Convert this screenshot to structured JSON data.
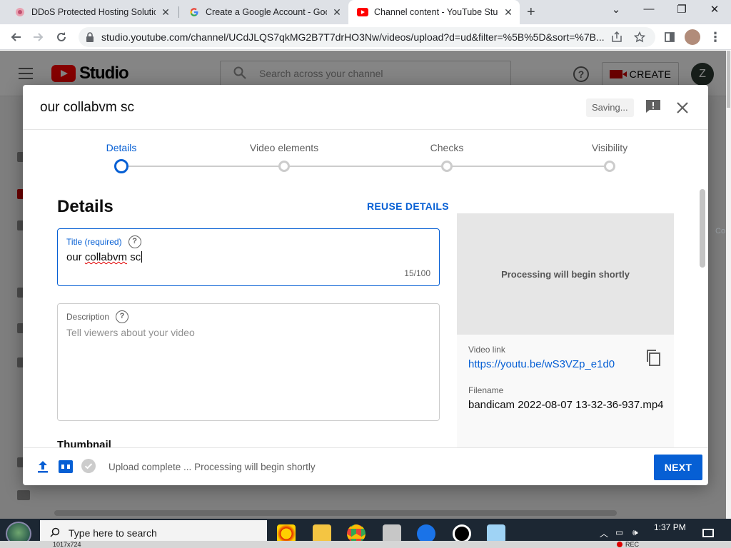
{
  "browser": {
    "tabs": [
      {
        "title": "DDoS Protected Hosting Solution",
        "icon": "ddos-favicon"
      },
      {
        "title": "Create a Google Account - Goog",
        "icon": "google-favicon"
      },
      {
        "title": "Channel content - YouTube Studi",
        "icon": "youtube-favicon",
        "active": true
      }
    ],
    "address": "studio.youtube.com/channel/UCdJLQS7qkMG2B7T7drHO3Nw/videos/upload?d=ud&filter=%5B%5D&sort=%7B...",
    "window_controls": {
      "minimize": "—",
      "restore": "❐",
      "close": "✕",
      "menu": "⌄"
    }
  },
  "studio": {
    "logo_text": "Studio",
    "search_placeholder": "Search across your channel",
    "create_label": "CREATE",
    "avatar_letter": "Z",
    "side_text": "Co"
  },
  "dialog": {
    "title": "our collabvm sc",
    "saving_label": "Saving...",
    "steps": [
      {
        "label": "Details",
        "active": true
      },
      {
        "label": "Video elements",
        "active": false
      },
      {
        "label": "Checks",
        "active": false
      },
      {
        "label": "Visibility",
        "active": false
      }
    ],
    "section_title": "Details",
    "reuse_label": "REUSE DETAILS",
    "title_field": {
      "label": "Title (required)",
      "value_a": "our ",
      "value_b": "collabvm",
      "value_c": " sc",
      "count": "15/100"
    },
    "description_field": {
      "label": "Description",
      "placeholder": "Tell viewers about your video"
    },
    "thumbnail_title": "Thumbnail",
    "preview": {
      "status": "Processing will begin shortly",
      "link_label": "Video link",
      "link": "https://youtu.be/wS3VZp_e1d0",
      "filename_label": "Filename",
      "filename": "bandicam 2022-08-07 13-32-36-937.mp4"
    },
    "footer": {
      "status": "Upload complete ... Processing will begin shortly",
      "next_label": "NEXT",
      "hd_badge": "HD"
    }
  },
  "taskbar": {
    "search_placeholder": "Type here to search",
    "time": "1:37 PM"
  },
  "statusbar": {
    "resolution": "1017x724",
    "rec": "REC"
  },
  "colors": {
    "accent": "#065fd4",
    "youtube_red": "#ff0000"
  }
}
